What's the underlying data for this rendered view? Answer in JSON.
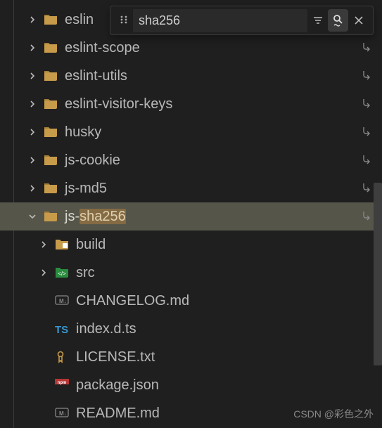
{
  "search": {
    "value": "sha256",
    "placeholder": "Search"
  },
  "highlight": "sha256",
  "tree": [
    {
      "name": "eslin",
      "type": "folder",
      "chev": true,
      "trunc": true,
      "short": true
    },
    {
      "name": "eslint-scope",
      "type": "folder",
      "chev": true,
      "short": true
    },
    {
      "name": "eslint-utils",
      "type": "folder",
      "chev": true,
      "short": true
    },
    {
      "name": "eslint-visitor-keys",
      "type": "folder",
      "chev": true,
      "short": true
    },
    {
      "name": "husky",
      "type": "folder",
      "chev": true,
      "short": true
    },
    {
      "name": "js-cookie",
      "type": "folder",
      "chev": true,
      "short": true
    },
    {
      "name": "js-md5",
      "type": "folder",
      "chev": true,
      "short": true
    },
    {
      "name": "js-sha256",
      "type": "folder",
      "chev": true,
      "short": true,
      "expanded": true,
      "active": true,
      "children": [
        {
          "name": "build",
          "type": "buildfolder",
          "chev": true
        },
        {
          "name": "src",
          "type": "srcfolder",
          "chev": true
        },
        {
          "name": "CHANGELOG.md",
          "type": "md"
        },
        {
          "name": "index.d.ts",
          "type": "ts"
        },
        {
          "name": "LICENSE.txt",
          "type": "license"
        },
        {
          "name": "package.json",
          "type": "npm"
        },
        {
          "name": "README.md",
          "type": "md"
        }
      ]
    }
  ],
  "iconColors": {
    "folder": "#c79b4a",
    "buildfolder": "#c79b4a",
    "srcfolder": "#2a8c3f",
    "md": "#888888",
    "ts": "#3896d0",
    "license": "#c79b4a",
    "npm": "#b53535"
  },
  "watermark": "CSDN @彩色之外"
}
